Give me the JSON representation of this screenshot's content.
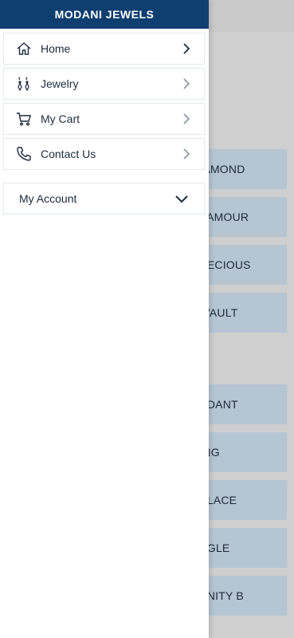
{
  "app": {
    "title": "MODANI JEWELS"
  },
  "menu": {
    "items": [
      {
        "label": "Home",
        "icon": "home-icon"
      },
      {
        "label": "Jewelry",
        "icon": "earrings-icon"
      },
      {
        "label": "My Cart",
        "icon": "cart-icon"
      },
      {
        "label": "Contact Us",
        "icon": "phone-icon"
      }
    ],
    "account": {
      "label": "My Account",
      "icon": "chevron-down-icon"
    }
  },
  "background": {
    "tiles": [
      {
        "label": "DIAMOND"
      },
      {
        "label": "GLAMOUR"
      },
      {
        "label": "PRECIOUS"
      },
      {
        "label": "D VAULT"
      },
      {
        "label": "ENDANT"
      },
      {
        "label": "RING"
      },
      {
        "label": "CKLACE"
      },
      {
        "label": "ANGLE"
      },
      {
        "label": "ERNITY B"
      }
    ]
  },
  "colors": {
    "header": "#0f3e70",
    "tile": "#b6c5d2",
    "overlay": "#cfcfcf"
  }
}
